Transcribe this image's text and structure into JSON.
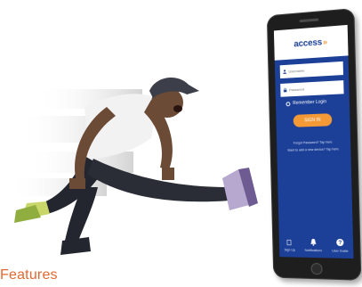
{
  "page": {
    "features_heading": "Features"
  },
  "app": {
    "logo": {
      "text": "access",
      "arrows": "»"
    },
    "login": {
      "username_placeholder": "Username",
      "password_placeholder": "Password",
      "remember_label": "Remember Login",
      "signin_label": "SIGN IN",
      "forgot_link": "Forgot Password? Tap here.",
      "new_device_link": "Want to add a new device? Tap here."
    },
    "bottom_nav": [
      {
        "label": "Sign Up",
        "icon": "signup-icon"
      },
      {
        "label": "Notifications",
        "icon": "bell-icon"
      },
      {
        "label": "User Guide",
        "icon": "help-icon"
      }
    ]
  },
  "colors": {
    "brand_blue": "#1c3f97",
    "brand_orange": "#f39a36",
    "heading_orange": "#e2692e"
  }
}
